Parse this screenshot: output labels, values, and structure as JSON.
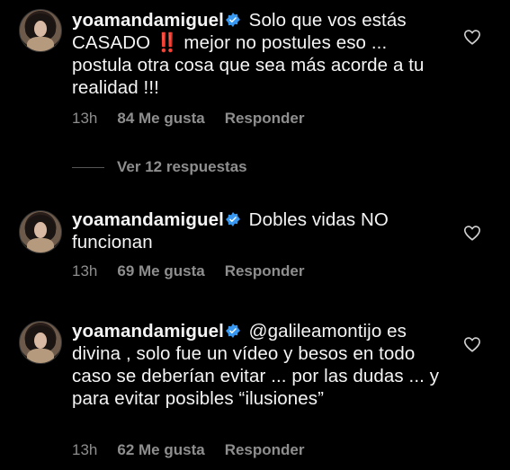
{
  "comments": [
    {
      "username": "yoamandamiguel",
      "text_before": " Solo que vos estás CASADO ",
      "emphasis": "‼️",
      "text_after": " mejor no postules eso ... postula otra cosa que sea más acorde a tu realidad !!!",
      "time": "13h",
      "likes": "84 Me gusta",
      "reply": "Responder"
    },
    {
      "username": "yoamandamiguel",
      "text": " Dobles vidas NO funcionan",
      "time": "13h",
      "likes": "69 Me gusta",
      "reply": "Responder"
    },
    {
      "username": "yoamandamiguel",
      "text": " @galileamontijo es divina , solo fue un vídeo y besos en todo caso se deberían evitar ... por las dudas ... y para evitar posibles “ilusiones”",
      "time": "13h",
      "likes": "62 Me gusta",
      "reply": "Responder"
    }
  ],
  "view_replies": "Ver 12 respuestas",
  "colors": {
    "background": "#000000",
    "text": "#f5f5f5",
    "muted": "#8e8e8e",
    "verified": "#3897f0"
  },
  "icons": {
    "verified": "verified-badge-icon",
    "like": "heart-icon"
  }
}
